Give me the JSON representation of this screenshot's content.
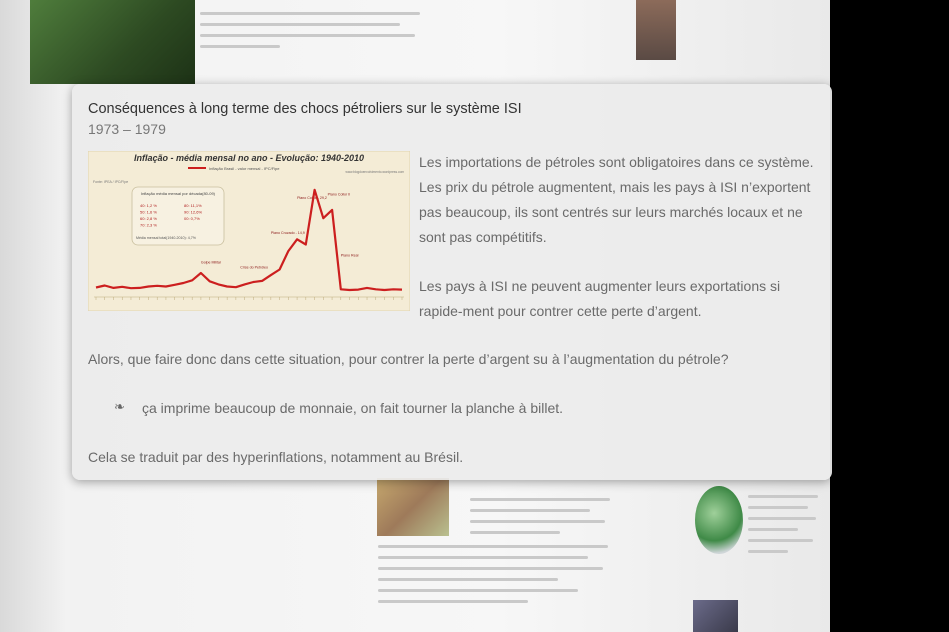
{
  "card": {
    "title": "Conséquences à long terme des chocs pétroliers sur le système ISI",
    "dates": "1973 – 1979",
    "para1": "Les importations de pétroles sont obligatoires dans ce système. Les prix du pétrole augmentent, mais les pays à ISI n’exportent pas beaucoup, ils sont centrés sur leurs marchés locaux et ne sont pas compétitifs.",
    "para2": "Les pays à ISI ne peuvent augmenter leurs exportations si rapide-ment pour contrer cette perte d’argent.",
    "question": "Alors, que faire donc dans cette situation, pour contrer la perte d’argent su à l’augmentation du pétrole?",
    "bullet_icon": "fleuron-icon",
    "bullet_glyph": "❧",
    "bullet_text": "ça imprime beaucoup de monnaie, on fait tourner la planche à billet.",
    "conclusion": "Cela se traduit par des hyperinflations, notamment au Brésil."
  },
  "chart": {
    "title": "Inflação - média mensal no ano - Evolução: 1940-2010",
    "legend": "Inflação Brasil - valor mensal - IPC/Fipe",
    "source": "www.blogdoenvolvimento.wordpress.com",
    "fonte": "Fonte: IPEA / IPC/Fipe",
    "box_title": "Inflação média mensal por década(80-09)",
    "box_rows": [
      "40: 1,2 %",
      "50: 1,6 %",
      "60: 2,8 %",
      "70: 2,3 %",
      "80: 11,1%",
      "90: 12,6%",
      "00: 0,7%"
    ],
    "box_total": "Média mensal total(1940-2010): 4,7%",
    "annotations": [
      "Plano Collor - 29,2",
      "Plano Collor II",
      "Plano Cruzado - 14,9",
      "Plano Real",
      "Crise do Petróleo",
      "Golpe Militar"
    ],
    "line_color": "#cc1f1f",
    "x": [
      1940,
      1942,
      1944,
      1946,
      1948,
      1950,
      1952,
      1954,
      1956,
      1958,
      1960,
      1962,
      1964,
      1966,
      1968,
      1970,
      1972,
      1974,
      1976,
      1978,
      1980,
      1982,
      1984,
      1986,
      1988,
      1990,
      1992,
      1994,
      1996,
      1998,
      2000,
      2002,
      2004,
      2006,
      2008,
      2010
    ],
    "values": [
      1.0,
      1.6,
      0.9,
      1.2,
      0.8,
      0.9,
      1.3,
      1.5,
      1.3,
      1.8,
      2.3,
      3.1,
      5.2,
      2.8,
      1.9,
      1.3,
      1.1,
      1.9,
      2.6,
      2.9,
      4.6,
      6.2,
      11.5,
      14.9,
      13.4,
      29.2,
      21.0,
      23.4,
      0.5,
      0.3,
      0.4,
      0.9,
      0.5,
      0.3,
      0.5,
      0.4
    ]
  }
}
